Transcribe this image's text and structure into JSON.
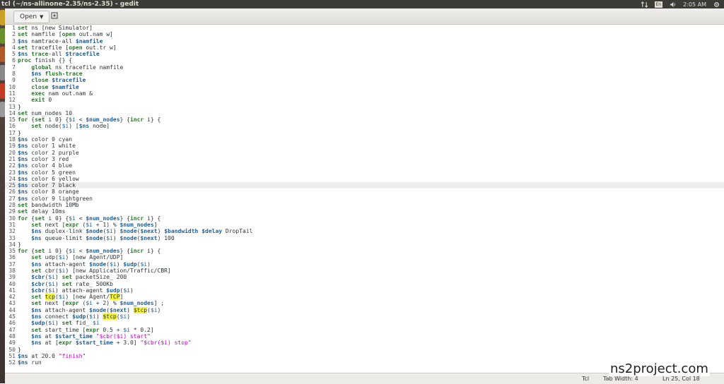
{
  "window": {
    "title": "tcl (~/ns-allinone-2.35/ns-2.35) - gedit"
  },
  "tray": {
    "keyboard": "En",
    "time": "2:05 AM"
  },
  "toolbar": {
    "open_label": "Open"
  },
  "code_lines": [
    [
      [
        "kw",
        "set"
      ],
      [
        "t",
        " ns [new Simulator]"
      ]
    ],
    [
      [
        "kw",
        "set"
      ],
      [
        "t",
        " namfile ["
      ],
      [
        "kw",
        "open"
      ],
      [
        "t",
        " out.nam w]"
      ]
    ],
    [
      [
        "var",
        "$ns"
      ],
      [
        "t",
        " namtrace-all "
      ],
      [
        "var",
        "$namfile"
      ]
    ],
    [
      [
        "kw",
        "set"
      ],
      [
        "t",
        " tracefile ["
      ],
      [
        "kw",
        "open"
      ],
      [
        "t",
        " out.tr w]"
      ]
    ],
    [
      [
        "var",
        "$ns"
      ],
      [
        "t",
        " "
      ],
      [
        "kw",
        "trace"
      ],
      [
        "t",
        "-all "
      ],
      [
        "var",
        "$tracefile"
      ]
    ],
    [
      [
        "kw",
        "proc"
      ],
      [
        "t",
        " finish {} {"
      ]
    ],
    [
      [
        "t",
        "    "
      ],
      [
        "kw",
        "global"
      ],
      [
        "t",
        " ns tracefile namfile"
      ]
    ],
    [
      [
        "t",
        "    "
      ],
      [
        "var",
        "$ns"
      ],
      [
        "t",
        " "
      ],
      [
        "kw",
        "flush-trace"
      ]
    ],
    [
      [
        "t",
        "    "
      ],
      [
        "kw",
        "close"
      ],
      [
        "t",
        " "
      ],
      [
        "var",
        "$tracefile"
      ]
    ],
    [
      [
        "t",
        "    "
      ],
      [
        "kw",
        "close"
      ],
      [
        "t",
        " "
      ],
      [
        "var",
        "$namfile"
      ]
    ],
    [
      [
        "t",
        "    "
      ],
      [
        "kw",
        "exec"
      ],
      [
        "t",
        " nam out.nam &"
      ]
    ],
    [
      [
        "t",
        "    "
      ],
      [
        "kw",
        "exit"
      ],
      [
        "t",
        " 0"
      ]
    ],
    [
      [
        "t",
        "}"
      ]
    ],
    [
      [
        "kw",
        "set"
      ],
      [
        "t",
        " num_nodes 10"
      ]
    ],
    [
      [
        "kw",
        "for"
      ],
      [
        "t",
        " {"
      ],
      [
        "kw",
        "set"
      ],
      [
        "t",
        " i 0} {"
      ],
      [
        "vr",
        "$i"
      ],
      [
        "t",
        " < "
      ],
      [
        "var",
        "$num_nodes"
      ],
      [
        "t",
        "} {"
      ],
      [
        "kw",
        "incr"
      ],
      [
        "t",
        " i} {"
      ]
    ],
    [
      [
        "t",
        "    "
      ],
      [
        "kw",
        "set"
      ],
      [
        "t",
        " node("
      ],
      [
        "vr",
        "$i"
      ],
      [
        "t",
        ") ["
      ],
      [
        "var",
        "$ns"
      ],
      [
        "t",
        " node]"
      ]
    ],
    [
      [
        "t",
        "}"
      ]
    ],
    [
      [
        "var",
        "$ns"
      ],
      [
        "t",
        " color 0 cyan"
      ]
    ],
    [
      [
        "var",
        "$ns"
      ],
      [
        "t",
        " color 1 white"
      ]
    ],
    [
      [
        "var",
        "$ns"
      ],
      [
        "t",
        " color 2 purple"
      ]
    ],
    [
      [
        "var",
        "$ns"
      ],
      [
        "t",
        " color 3 red"
      ]
    ],
    [
      [
        "var",
        "$ns"
      ],
      [
        "t",
        " color 4 blue"
      ]
    ],
    [
      [
        "var",
        "$ns"
      ],
      [
        "t",
        " color 5 green"
      ]
    ],
    [
      [
        "var",
        "$ns"
      ],
      [
        "t",
        " color 6 yellow"
      ]
    ],
    [
      [
        "var",
        "$ns"
      ],
      [
        "t",
        " color 7 black"
      ]
    ],
    [
      [
        "var",
        "$ns"
      ],
      [
        "t",
        " color 8 orange"
      ]
    ],
    [
      [
        "var",
        "$ns"
      ],
      [
        "t",
        " color 9 lightgreen"
      ]
    ],
    [
      [
        "kw",
        "set"
      ],
      [
        "t",
        " bandwidth 10Mb"
      ]
    ],
    [
      [
        "kw",
        "set"
      ],
      [
        "t",
        " delay 10ms"
      ]
    ],
    [
      [
        "kw",
        "for"
      ],
      [
        "t",
        " {"
      ],
      [
        "kw",
        "set"
      ],
      [
        "t",
        " i 0} {"
      ],
      [
        "vr",
        "$i"
      ],
      [
        "t",
        " < "
      ],
      [
        "var",
        "$num_nodes"
      ],
      [
        "t",
        "} {"
      ],
      [
        "kw",
        "incr"
      ],
      [
        "t",
        " i} {"
      ]
    ],
    [
      [
        "t",
        "    "
      ],
      [
        "kw",
        "set"
      ],
      [
        "t",
        " next ["
      ],
      [
        "kw",
        "expr"
      ],
      [
        "t",
        " ("
      ],
      [
        "vr",
        "$i"
      ],
      [
        "t",
        " + 1) % "
      ],
      [
        "var",
        "$num_nodes"
      ],
      [
        "t",
        "]"
      ]
    ],
    [
      [
        "t",
        "    "
      ],
      [
        "var",
        "$ns"
      ],
      [
        "t",
        " duplex-link "
      ],
      [
        "var",
        "$node"
      ],
      [
        "t",
        "("
      ],
      [
        "vr",
        "$i"
      ],
      [
        "t",
        ") "
      ],
      [
        "var",
        "$node"
      ],
      [
        "t",
        "("
      ],
      [
        "var",
        "$next"
      ],
      [
        "t",
        ") "
      ],
      [
        "var",
        "$bandwidth"
      ],
      [
        "t",
        " "
      ],
      [
        "var",
        "$delay"
      ],
      [
        "t",
        " DropTail"
      ]
    ],
    [
      [
        "t",
        "    "
      ],
      [
        "var",
        "$ns"
      ],
      [
        "t",
        " queue-limit "
      ],
      [
        "var",
        "$node"
      ],
      [
        "t",
        "("
      ],
      [
        "vr",
        "$i"
      ],
      [
        "t",
        ") "
      ],
      [
        "var",
        "$node"
      ],
      [
        "t",
        "("
      ],
      [
        "var",
        "$next"
      ],
      [
        "t",
        ") 100"
      ]
    ],
    [
      [
        "t",
        "}"
      ]
    ],
    [
      [
        "kw",
        "for"
      ],
      [
        "t",
        " {"
      ],
      [
        "kw",
        "set"
      ],
      [
        "t",
        " i 0} {"
      ],
      [
        "vr",
        "$i"
      ],
      [
        "t",
        " < "
      ],
      [
        "var",
        "$num_nodes"
      ],
      [
        "t",
        "} {"
      ],
      [
        "kw",
        "incr"
      ],
      [
        "t",
        " i} {"
      ]
    ],
    [
      [
        "t",
        "    "
      ],
      [
        "kw",
        "set"
      ],
      [
        "t",
        " udp("
      ],
      [
        "vr",
        "$i"
      ],
      [
        "t",
        ") [new Agent/UDP]"
      ]
    ],
    [
      [
        "t",
        "    "
      ],
      [
        "var",
        "$ns"
      ],
      [
        "t",
        " attach-agent "
      ],
      [
        "var",
        "$node"
      ],
      [
        "t",
        "("
      ],
      [
        "vr",
        "$i"
      ],
      [
        "t",
        ") "
      ],
      [
        "var",
        "$udp"
      ],
      [
        "t",
        "("
      ],
      [
        "vr",
        "$i"
      ],
      [
        "t",
        ")"
      ]
    ],
    [
      [
        "t",
        "    "
      ],
      [
        "kw",
        "set"
      ],
      [
        "t",
        " cbr("
      ],
      [
        "vr",
        "$i"
      ],
      [
        "t",
        ") [new Application/Traffic/CBR]"
      ]
    ],
    [
      [
        "t",
        "    "
      ],
      [
        "var",
        "$cbr"
      ],
      [
        "t",
        "("
      ],
      [
        "vr",
        "$i"
      ],
      [
        "t",
        ") "
      ],
      [
        "kw",
        "set"
      ],
      [
        "t",
        " packetSize_ 200"
      ]
    ],
    [
      [
        "t",
        "    "
      ],
      [
        "var",
        "$cbr"
      ],
      [
        "t",
        "("
      ],
      [
        "vr",
        "$i"
      ],
      [
        "t",
        ") "
      ],
      [
        "kw",
        "set"
      ],
      [
        "t",
        " rate_ 500Kb"
      ]
    ],
    [
      [
        "t",
        "    "
      ],
      [
        "var",
        "$cbr"
      ],
      [
        "t",
        "("
      ],
      [
        "vr",
        "$i"
      ],
      [
        "t",
        ") attach-agent "
      ],
      [
        "var",
        "$udp"
      ],
      [
        "t",
        "("
      ],
      [
        "vr",
        "$i"
      ],
      [
        "t",
        ")"
      ]
    ],
    [
      [
        "t",
        "    "
      ],
      [
        "kw",
        "set"
      ],
      [
        "t",
        " "
      ],
      [
        "hl",
        "tcp"
      ],
      [
        "t",
        "("
      ],
      [
        "vr",
        "$i"
      ],
      [
        "t",
        ") [new Agent/"
      ],
      [
        "hl",
        "TCP"
      ],
      [
        "t",
        "]"
      ]
    ],
    [
      [
        "t",
        "    "
      ],
      [
        "kw",
        "set"
      ],
      [
        "t",
        " next ["
      ],
      [
        "kw",
        "expr"
      ],
      [
        "t",
        " ("
      ],
      [
        "vr",
        "$i"
      ],
      [
        "t",
        " + 2) % "
      ],
      [
        "var",
        "$num_nodes"
      ],
      [
        "t",
        "] ;"
      ]
    ],
    [
      [
        "t",
        "    "
      ],
      [
        "var",
        "$ns"
      ],
      [
        "t",
        " attach-agent "
      ],
      [
        "var",
        "$node"
      ],
      [
        "t",
        "("
      ],
      [
        "var",
        "$next"
      ],
      [
        "t",
        ") "
      ],
      [
        "hl",
        "$tcp"
      ],
      [
        "t",
        "("
      ],
      [
        "vr",
        "$i"
      ],
      [
        "t",
        ")"
      ]
    ],
    [
      [
        "t",
        "    "
      ],
      [
        "var",
        "$ns"
      ],
      [
        "t",
        " connect "
      ],
      [
        "var",
        "$udp"
      ],
      [
        "t",
        "("
      ],
      [
        "vr",
        "$i"
      ],
      [
        "t",
        ") "
      ],
      [
        "hl",
        "$tcp"
      ],
      [
        "t",
        "("
      ],
      [
        "vr",
        "$i"
      ],
      [
        "t",
        ")"
      ]
    ],
    [
      [
        "t",
        "    "
      ],
      [
        "var",
        "$udp"
      ],
      [
        "t",
        "("
      ],
      [
        "vr",
        "$i"
      ],
      [
        "t",
        ") "
      ],
      [
        "kw",
        "set"
      ],
      [
        "t",
        " fid_ "
      ],
      [
        "vr",
        "$i"
      ]
    ],
    [
      [
        "t",
        "    "
      ],
      [
        "kw",
        "set"
      ],
      [
        "t",
        " start_time ["
      ],
      [
        "kw",
        "expr"
      ],
      [
        "t",
        " 0.5 + "
      ],
      [
        "vr",
        "$i"
      ],
      [
        "t",
        " * 0.2]"
      ]
    ],
    [
      [
        "t",
        "    "
      ],
      [
        "var",
        "$ns"
      ],
      [
        "t",
        " at "
      ],
      [
        "var",
        "$start_time"
      ],
      [
        "t",
        " "
      ],
      [
        "st",
        "\"$cbr($i) start\""
      ]
    ],
    [
      [
        "t",
        "    "
      ],
      [
        "var",
        "$ns"
      ],
      [
        "t",
        " at ["
      ],
      [
        "kw",
        "expr"
      ],
      [
        "t",
        " "
      ],
      [
        "var",
        "$start_time"
      ],
      [
        "t",
        " + 3.0] "
      ],
      [
        "st",
        "\"$cbr($i) stop\""
      ]
    ],
    [
      [
        "t",
        "}"
      ]
    ],
    [
      [
        "var",
        "$ns"
      ],
      [
        "t",
        " at 20.0 "
      ],
      [
        "st",
        "\"finish\""
      ]
    ],
    [
      [
        "var",
        "$ns"
      ],
      [
        "t",
        " run"
      ]
    ]
  ],
  "current_line": 25,
  "status": {
    "language": "Tcl",
    "tab_width": "Tab Width: 4",
    "position": "Ln 25, Col 18"
  },
  "watermark": "ns2project.com"
}
